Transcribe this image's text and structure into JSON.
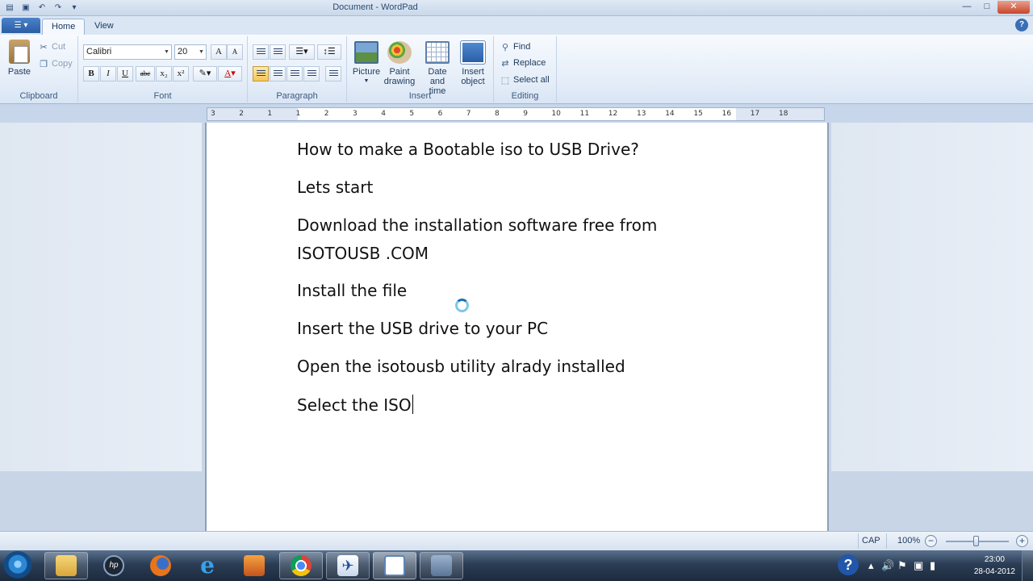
{
  "window": {
    "title": "Document - WordPad",
    "controls": {
      "minimize": "—",
      "maximize": "□",
      "close": "✕"
    },
    "qat_icons": [
      "save-icon",
      "undo-icon",
      "redo-icon",
      "customize-icon"
    ]
  },
  "ribbon": {
    "app_menu_icon": "menu-icon",
    "tabs": [
      {
        "label": "Home",
        "active": true
      },
      {
        "label": "View",
        "active": false
      }
    ],
    "clipboard": {
      "paste": "Paste",
      "cut": "Cut",
      "copy": "Copy",
      "group_label": "Clipboard"
    },
    "font": {
      "family": "Calibri",
      "size": "20",
      "group_label": "Font",
      "grow": "A",
      "shrink": "A",
      "bold": "B",
      "italic": "I",
      "underline": "U",
      "strike": "abc",
      "subscript": "x₂",
      "superscript": "x²"
    },
    "paragraph": {
      "group_label": "Paragraph"
    },
    "insert": {
      "picture": "Picture",
      "paint_l1": "Paint",
      "paint_l2": "drawing",
      "date_l1": "Date and",
      "date_l2": "time",
      "obj_l1": "Insert",
      "obj_l2": "object",
      "group_label": "Insert"
    },
    "editing": {
      "find": "Find",
      "replace": "Replace",
      "select_all": "Select all",
      "group_label": "Editing"
    }
  },
  "ruler": {
    "ticks": [
      "3",
      "2",
      "1",
      "1",
      "2",
      "3",
      "4",
      "5",
      "6",
      "7",
      "8",
      "9",
      "10",
      "11",
      "12",
      "13",
      "14",
      "15",
      "16",
      "17",
      "18"
    ]
  },
  "document": {
    "lines": [
      "How to make a Bootable iso to USB Drive?",
      "Lets start",
      "Download the installation software free from",
      "ISOTOUSB .COM",
      "Install the file",
      "Insert the USB drive to your PC",
      "Open the isotousb utility alrady installed",
      "Select the ISO"
    ]
  },
  "status": {
    "caps": "CAP",
    "zoom": "100%",
    "zoom_out": "−",
    "zoom_in": "+"
  },
  "taskbar": {
    "apps": [
      "windows-explorer",
      "hp",
      "firefox",
      "internet-explorer",
      "media-player",
      "chrome",
      "app-6",
      "wordpad",
      "remote"
    ],
    "clock_time": "23:00",
    "clock_date": "28-04-2012"
  }
}
